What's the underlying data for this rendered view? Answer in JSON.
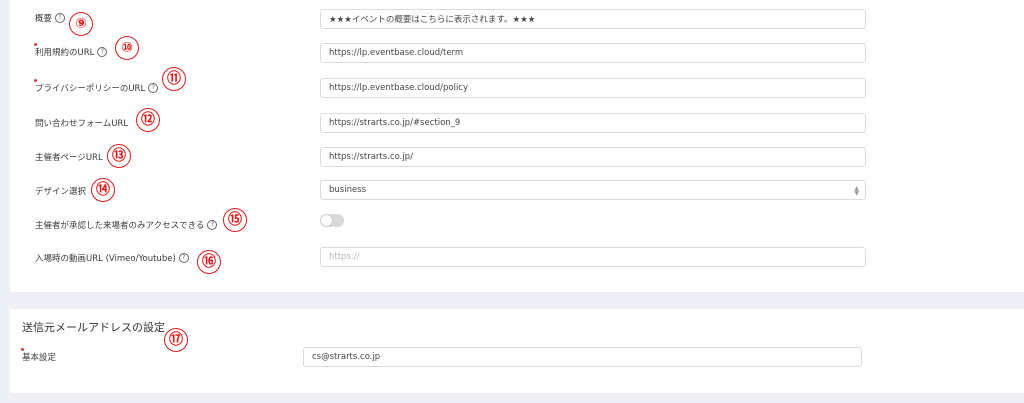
{
  "fields": [
    {
      "label": "概要",
      "has_help": true,
      "required": false,
      "marker": "⑨",
      "value": "★★★イベントの概要はこちらに表示されます。★★★",
      "placeholder": ""
    },
    {
      "label": "利用規約のURL",
      "has_help": true,
      "required": true,
      "marker": "⑩",
      "value": "https://lp.eventbase.cloud/term",
      "placeholder": ""
    },
    {
      "label": "プライバシーポリシーのURL",
      "has_help": true,
      "required": true,
      "marker": "⑪",
      "value": "https://lp.eventbase.cloud/policy",
      "placeholder": ""
    },
    {
      "label": "問い合わせフォームURL",
      "has_help": false,
      "required": false,
      "marker": "⑫",
      "value": "https://strarts.co.jp/#section_9",
      "placeholder": ""
    },
    {
      "label": "主催者ページURL",
      "has_help": false,
      "required": false,
      "marker": "⑬",
      "value": "https://strarts.co.jp/",
      "placeholder": ""
    },
    {
      "label": "デザイン選択",
      "has_help": false,
      "required": false,
      "marker": "⑭",
      "value": "business",
      "placeholder": ""
    },
    {
      "label": "主催者が承認した来場者のみアクセスできる",
      "has_help": true,
      "required": false,
      "marker": "⑮",
      "toggle_on": false
    },
    {
      "label": "入場時の動画URL (Vimeo/Youtube)",
      "has_help": true,
      "required": false,
      "marker": "⑯",
      "value": "",
      "placeholder": "https://"
    }
  ],
  "sender_section": {
    "title": "送信元メールアドレスの設定",
    "marker": "⑰",
    "field_label": "基本設定",
    "field_value": "cs@strarts.co.jp"
  },
  "help_glyph": "?",
  "colors": {
    "marker": "#e01919",
    "required_dot": "#e23b3b",
    "page_bg": "#eef0f6"
  }
}
